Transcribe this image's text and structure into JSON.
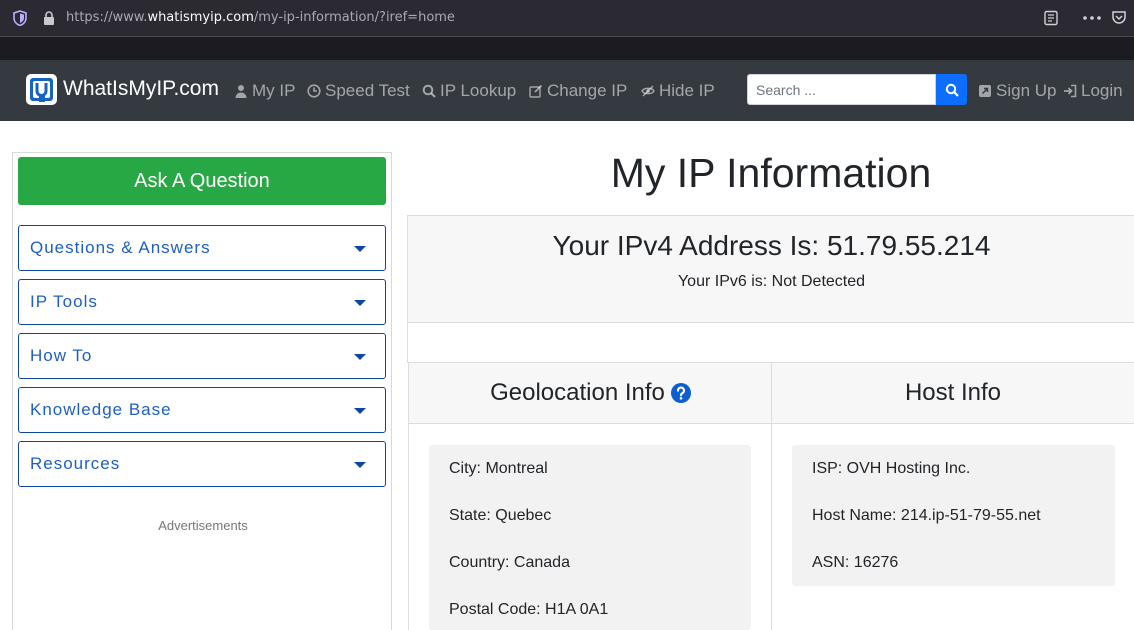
{
  "browser": {
    "url_scheme": "https://www.",
    "url_host": "whatismyip.com",
    "url_path": "/my-ip-information/?iref=home"
  },
  "navbar": {
    "brand": "WhatIsMyIP.com",
    "items": [
      {
        "label": "My IP",
        "icon": "user-icon"
      },
      {
        "label": "Speed Test",
        "icon": "clock-icon"
      },
      {
        "label": "IP Lookup",
        "icon": "search-icon"
      },
      {
        "label": "Change IP",
        "icon": "edit-icon"
      },
      {
        "label": "Hide IP",
        "icon": "eye-slash-icon"
      }
    ],
    "search_placeholder": "Search ...",
    "signup": "Sign Up",
    "login": "Login"
  },
  "sidebar": {
    "ask_button": "Ask A Question",
    "menu": [
      {
        "label": "Questions & Answers"
      },
      {
        "label": "IP Tools"
      },
      {
        "label": "How To"
      },
      {
        "label": "Knowledge Base"
      },
      {
        "label": "Resources"
      }
    ],
    "ads_label": "Advertisements"
  },
  "main": {
    "title": "My IP Information",
    "ipv4_text": "Your IPv4 Address Is: 51.79.55.214",
    "ipv6_text": "Your IPv6 is: Not Detected",
    "geolocation": {
      "heading": "Geolocation Info",
      "lines": [
        "City: Montreal",
        "State: Quebec",
        "Country: Canada",
        "Postal Code: H1A 0A1"
      ]
    },
    "host": {
      "heading": "Host Info",
      "lines": [
        "ISP: OVH Hosting Inc.",
        "Host Name: 214.ip-51-79-55.net",
        "ASN: 16276"
      ]
    }
  },
  "colors": {
    "navbar_bg": "#343a40",
    "ask_button_bg": "#28a745",
    "menu_border": "#0d47a1",
    "search_button_bg": "#0d6efd"
  }
}
